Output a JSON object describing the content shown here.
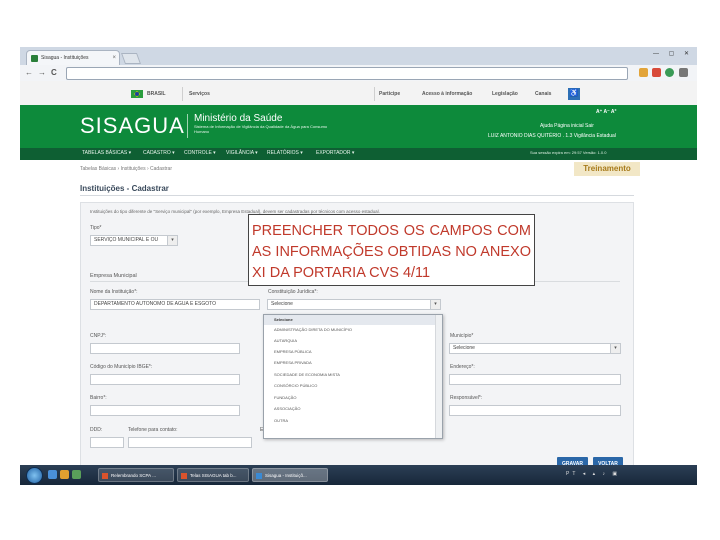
{
  "browser": {
    "tab_title": "Sisagua - Instituições",
    "tab_close": "×",
    "window_buttons": "— ▢ ✕",
    "back": "←",
    "forward": "→",
    "reload": "C"
  },
  "gov_bar": {
    "country": "BRASIL",
    "services": "Serviços",
    "links": [
      "Participe",
      "Acesso à informação",
      "Legislação",
      "Canais"
    ]
  },
  "header": {
    "app_name": "SISAGUA",
    "ministry": "Ministério da Saúde",
    "subtitle": "Sistema de Informação de Vigilância da Qualidade da Água para Consumo Humano",
    "font_controls": "A⁺ A⁻ A°",
    "top_links": "Ajuda  Página inicial  Sair",
    "user_line": "LUIZ ANTONIO DIAS QUITÉRIO . 1.3 Vigilância Estadual"
  },
  "menu": {
    "items": [
      "TABELAS BÁSICAS ▾",
      "CADASTRO ▾",
      "CONTROLE ▾",
      "VIGILÂNCIA ▾",
      "RELATÓRIOS ▾",
      "EXPORTADOR ▾"
    ],
    "session": "Sua sessão expira em: 29:57   Versão: 1.0.0"
  },
  "breadcrumb": "Tabelas Básicas  ›  Instituições  ›  Cadastrar",
  "environment_badge": "Treinamento",
  "page_title": "Instituições - Cadastrar",
  "info_text": "Instituições do tipo diferente de \"Serviço municipal\" (por exemplo, Empresa Estadual), devem ser cadastradas por técnicos com acesso estadual.",
  "form": {
    "tipo_label": "Tipo*",
    "tipo_value": "SERVIÇO MUNICIPAL E OU",
    "section_title": "Empresa Municipal",
    "nome_label": "Nome da Instituição*:",
    "nome_value": "DEPARTAMENTO AUTONOMO DE AGUA E ESGOTO",
    "constituicao_label": "Constituição Jurídica*:",
    "constituicao_value": "Selecione",
    "cnpj_label": "CNPJ*:",
    "municipio_label": "Município*",
    "municipio_value": "Selecione",
    "codigo_label": "Código do Município IBGE*:",
    "endereco_label": "Endereço*:",
    "bairro_label": "Bairro*:",
    "responsavel_label": "Responsável*:",
    "ddd_label": "DDD:",
    "telefone_label": "Telefone para contato:",
    "email_label": "E-",
    "dropdown_options": [
      "Selecione",
      "ADMINISTRAÇÃO DIRETA DO MUNICÍPIO",
      "AUTARQUIA",
      "EMPRESA PÚBLICA",
      "EMPRESA PRIVADA",
      "SOCIEDADE DE ECONOMIA MISTA",
      "CONSÓRCIO PÚBLICO",
      "FUNDAÇÃO",
      "ASSOCIAÇÃO",
      "OUTRA"
    ],
    "save_button": "GRAVAR",
    "back_button": "VOLTAR"
  },
  "annotation": "PREENCHER TODOS OS CAMPOS COM AS INFORMAÇÕES OBTIDAS NO ANEXO XI DA PORTARIA CVS 4/11",
  "taskbar": {
    "buttons": [
      "Relembrando SCPA ...",
      "Telas SISAGUA tab b...",
      "Sisagua - Instituiçõ..."
    ],
    "tray": "PT  ◂  ▴  ♪  ▣"
  }
}
